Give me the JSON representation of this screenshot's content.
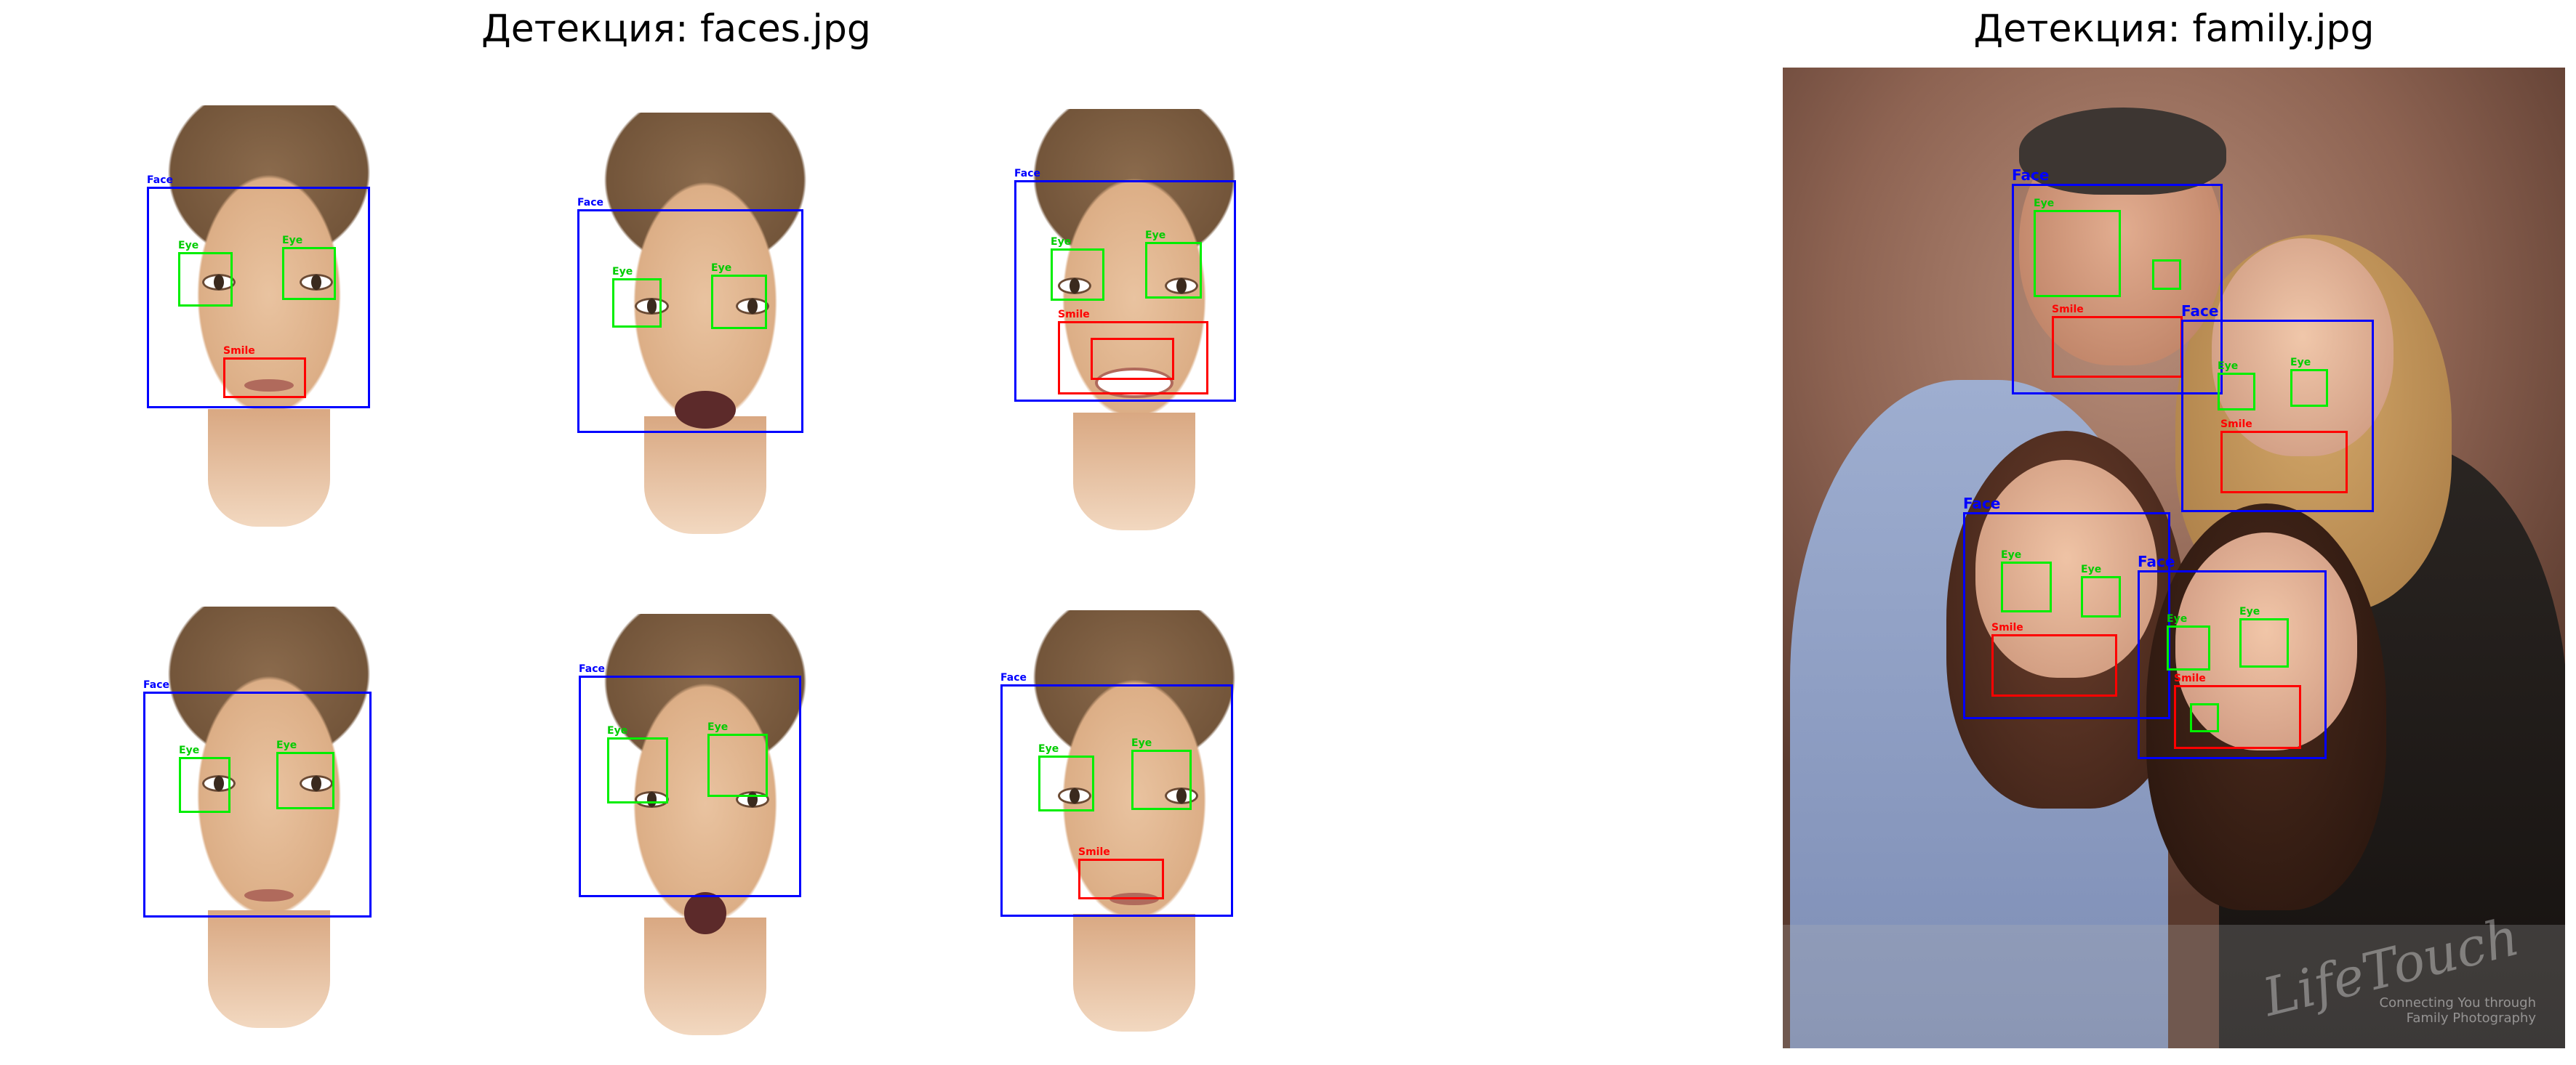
{
  "titles": {
    "left": "Детекция: faces.jpg",
    "right": "Детекция: family.jpg"
  },
  "labels": {
    "face": "Face",
    "eye": "Eye",
    "smile": "Smile"
  },
  "watermark": {
    "logo": "LifeTouch",
    "tagline_1": "Connecting You through",
    "tagline_2": "Family Photography"
  },
  "colors": {
    "face_box": "#0000ff",
    "eye_box": "#00ee00",
    "smile_box": "#ff0000"
  }
}
